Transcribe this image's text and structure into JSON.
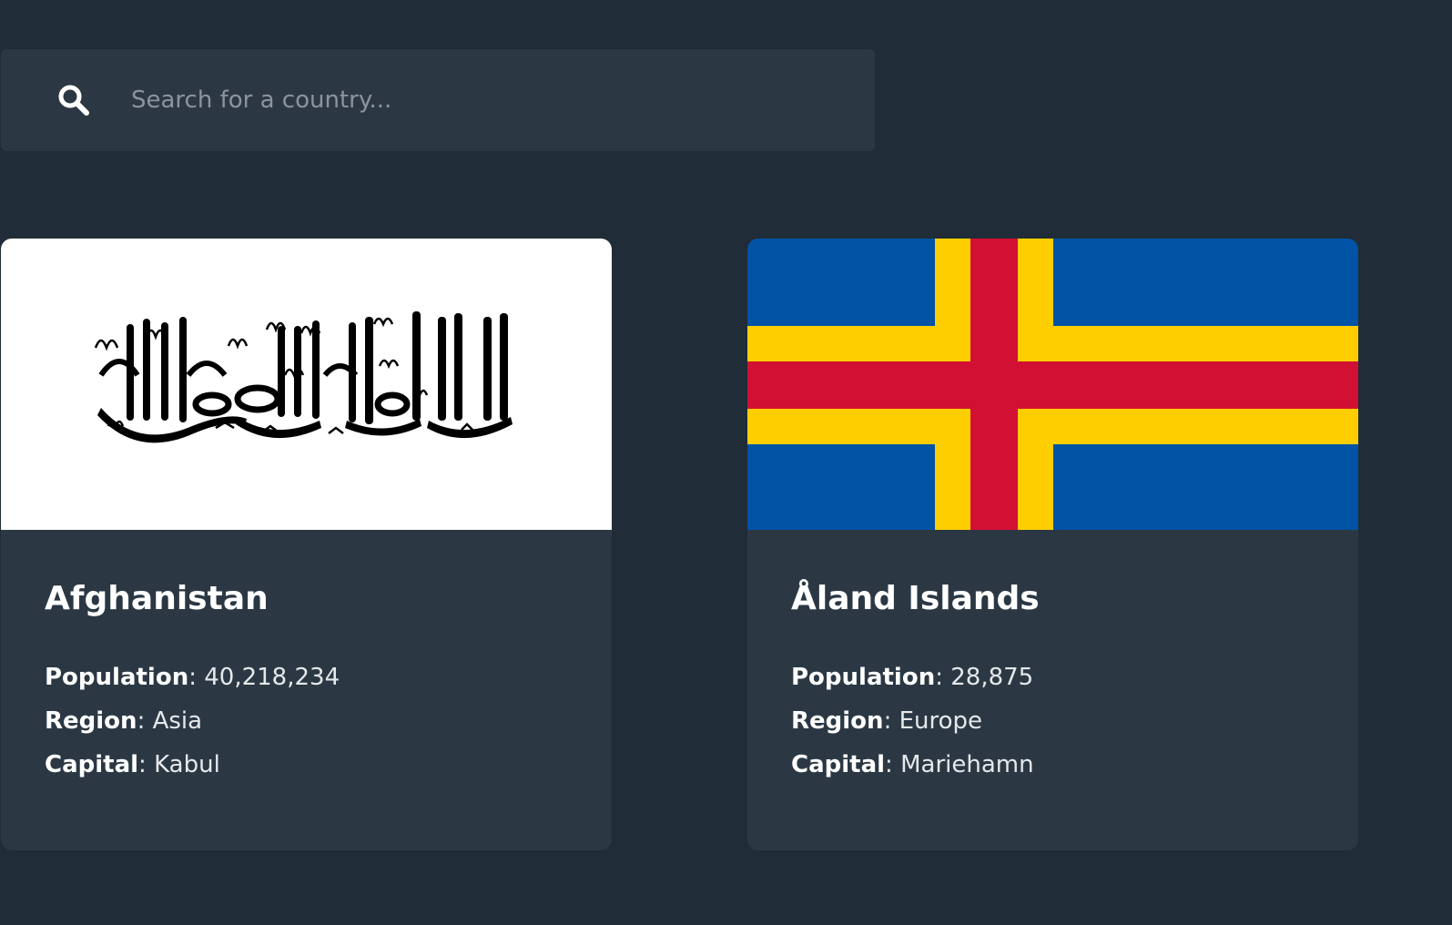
{
  "search": {
    "placeholder": "Search for a country...",
    "icon": "search-icon"
  },
  "countries": [
    {
      "name": "Afghanistan",
      "flag": "afghanistan-flag",
      "population_label": "Population",
      "population": "40,218,234",
      "region_label": "Region",
      "region": "Asia",
      "capital_label": "Capital",
      "capital": "Kabul"
    },
    {
      "name": "Åland Islands",
      "flag": "aland-islands-flag",
      "population_label": "Population",
      "population": "28,875",
      "region_label": "Region",
      "region": "Europe",
      "capital_label": "Capital",
      "capital": "Mariehamn"
    }
  ],
  "colors": {
    "background": "#202c37",
    "card": "#2b3844",
    "placeholder": "#8b949c",
    "aland_blue": "#0053a5",
    "aland_yellow": "#ffce00",
    "aland_red": "#d21034"
  }
}
